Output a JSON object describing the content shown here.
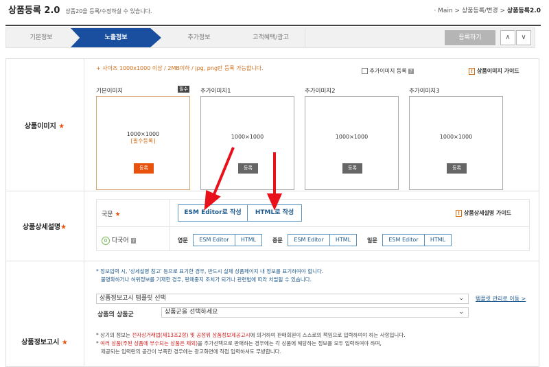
{
  "header": {
    "title": "상품등록 2.0",
    "subtitle": "상품20을 등록/수정하실 수 있습니다.",
    "breadcrumb": [
      "Main",
      "상품등록/변경",
      "상품등록2.0"
    ]
  },
  "steps": [
    "기본정보",
    "노출정보",
    "추가정보",
    "고객혜택/광고"
  ],
  "toolbar": {
    "register": "등록하기",
    "up": "∧",
    "down": "∨"
  },
  "image_section": {
    "label": "상품이미지",
    "notice": "+ 사이즈 1000x1000 이상 / 2MB이하 / jpg, png만 등록 가능합니다.",
    "extra_checkbox": "추가이미지 등록",
    "guide": "상품이미지 가이드",
    "required_badge": "필수",
    "boxes": [
      {
        "label": "기본이미지",
        "size": "1000×1000",
        "required": "[필수등록]",
        "button": "등록"
      },
      {
        "label": "추가이미지1",
        "size": "1000×1000",
        "button": "등록"
      },
      {
        "label": "추가이미지2",
        "size": "1000×1000",
        "button": "등록"
      },
      {
        "label": "추가이미지3",
        "size": "1000×1000",
        "button": "등록"
      }
    ]
  },
  "detail_section": {
    "label": "상품상세설명",
    "korean": "국문",
    "esm_write": "ESM Editor로 작성",
    "html_write": "HTML로 작성",
    "guide": "상품상세설명 가이드",
    "multi_count": "0",
    "multi": "다국어",
    "langs": [
      {
        "name": "영문",
        "esm": "ESM Editor",
        "html": "HTML"
      },
      {
        "name": "중문",
        "esm": "ESM Editor",
        "html": "HTML"
      },
      {
        "name": "일문",
        "esm": "ESM Editor",
        "html": "HTML"
      }
    ]
  },
  "info_section": {
    "label": "상품정보고시",
    "note1": "* 정보입력 시, '상세설명 참고' 등으로 표기한 경우, 반드시 실제 상품페이지 내 정보를 표기하여야 합니다.",
    "note2": "불명확하거나 허위정보를 기재한 경우, 판매중지 조치가 되거나 관련법에 따라 처벌될 수 있습니다.",
    "template_select": "상품정보고시 템플릿 선택",
    "template_link": "템플릿 관리로 이동 >",
    "group_label": "상품의 상품군",
    "group_select": "상품군을 선택하세요",
    "note3a": "* 상기의 정보는 ",
    "note3b": "전자상거래법(제13조2항) 및 공정위 상품정보제공고시",
    "note3c": "에 의거하여 판매회원이 스스로의 책임으로 입력하여야 하는 사항입니다.",
    "note4a": "* ",
    "note4b": "여러 상품(주된 상품에 부수되는 상품은 제외)",
    "note4c": "을 추가선택으로 판매하는 경우에는 각 상품에 해당하는 정보를 모두 입력하여야 하며,",
    "note5": "제공되는 입력란의 공간이 부족한 경우에는 광고화면에 직접 입력하셔도 무방합니다."
  },
  "colors": {
    "accent": "#1a4fa0",
    "star": "#e8520c",
    "arrow": "#e8101a"
  }
}
